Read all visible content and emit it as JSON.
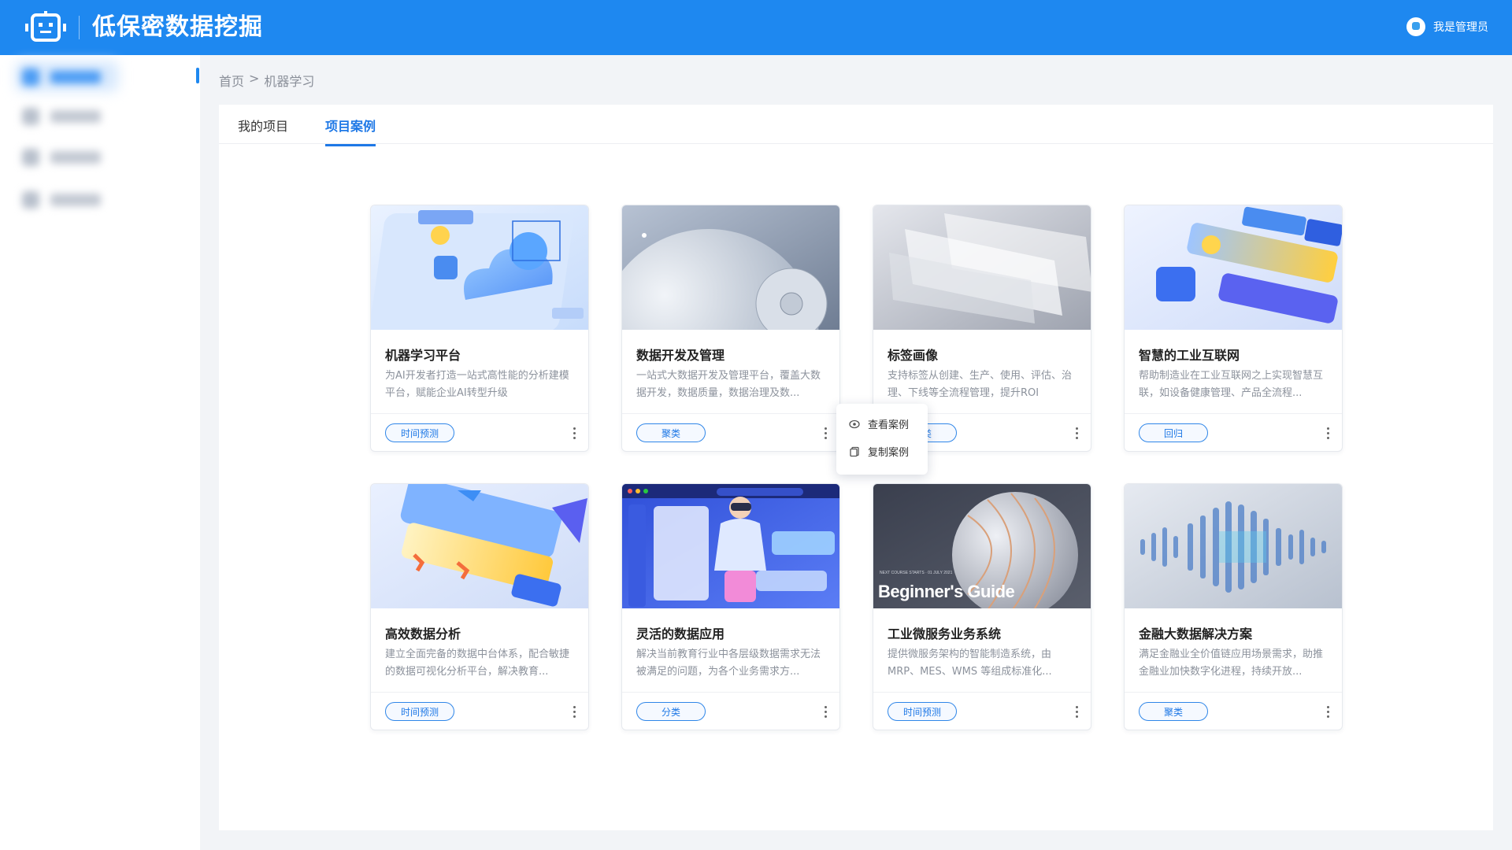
{
  "app": {
    "title": "低保密数据挖掘",
    "user_name": "我是管理员"
  },
  "breadcrumb": {
    "home": "首页",
    "separator": ">",
    "current": "机器学习"
  },
  "tabs": [
    {
      "label": "我的项目",
      "active": false
    },
    {
      "label": "项目案例",
      "active": true
    }
  ],
  "cards": [
    {
      "title": "机器学习平台",
      "desc": "为AI开发者打造一站式高性能的分析建模平台，赋能企业AI转型升级",
      "tag": "时间预测",
      "image": "cloud-illustration-icon"
    },
    {
      "title": "数据开发及管理",
      "desc": "一站式大数据开发及管理平台，覆盖大数据开发，数据质量，数据治理及数...",
      "tag": "聚类",
      "image": "planet-illustration-icon"
    },
    {
      "title": "标签画像",
      "desc": "支持标签从创建、生产、使用、评估、治理、下线等全流程管理，提升ROI",
      "tag": "聚类",
      "image": "glass-panels-illustration-icon"
    },
    {
      "title": "智慧的工业互联网",
      "desc": "帮助制造业在工业互联网之上实现智慧互联，如设备健康管理、产品全流程...",
      "tag": "回归",
      "image": "music-ui-illustration-icon"
    },
    {
      "title": "高效数据分析",
      "desc": "建立全面完备的数据中台体系，配合敏捷的数据可视化分析平台，解决教育...",
      "tag": "时间预测",
      "image": "analytics-illustration-icon"
    },
    {
      "title": "灵活的数据应用",
      "desc": "解决当前教育行业中各层级数据需求无法被满足的问题，为各个业务需求方...",
      "tag": "分类",
      "image": "vr-person-illustration-icon"
    },
    {
      "title": "工业微服务业务系统",
      "desc": "提供微服务架构的智能制造系统，由MRP、MES、WMS 等组成标准化...",
      "tag": "时间预测",
      "image": "sphere-illustration-icon",
      "thumb_caption": "Beginner's Guide",
      "thumb_small": "NEXT COURSE STARTS · 01 JULY 2021"
    },
    {
      "title": "金融大数据解决方案",
      "desc": "满足金融业全价值链应用场景需求，助推金融业加快数字化进程，持续开放...",
      "tag": "聚类",
      "image": "waveform-illustration-icon"
    }
  ],
  "context_menu": {
    "view_label": "查看案例",
    "copy_label": "复制案例"
  },
  "colors": {
    "primary": "#1e88f0",
    "tag_border": "#2f86e8"
  }
}
